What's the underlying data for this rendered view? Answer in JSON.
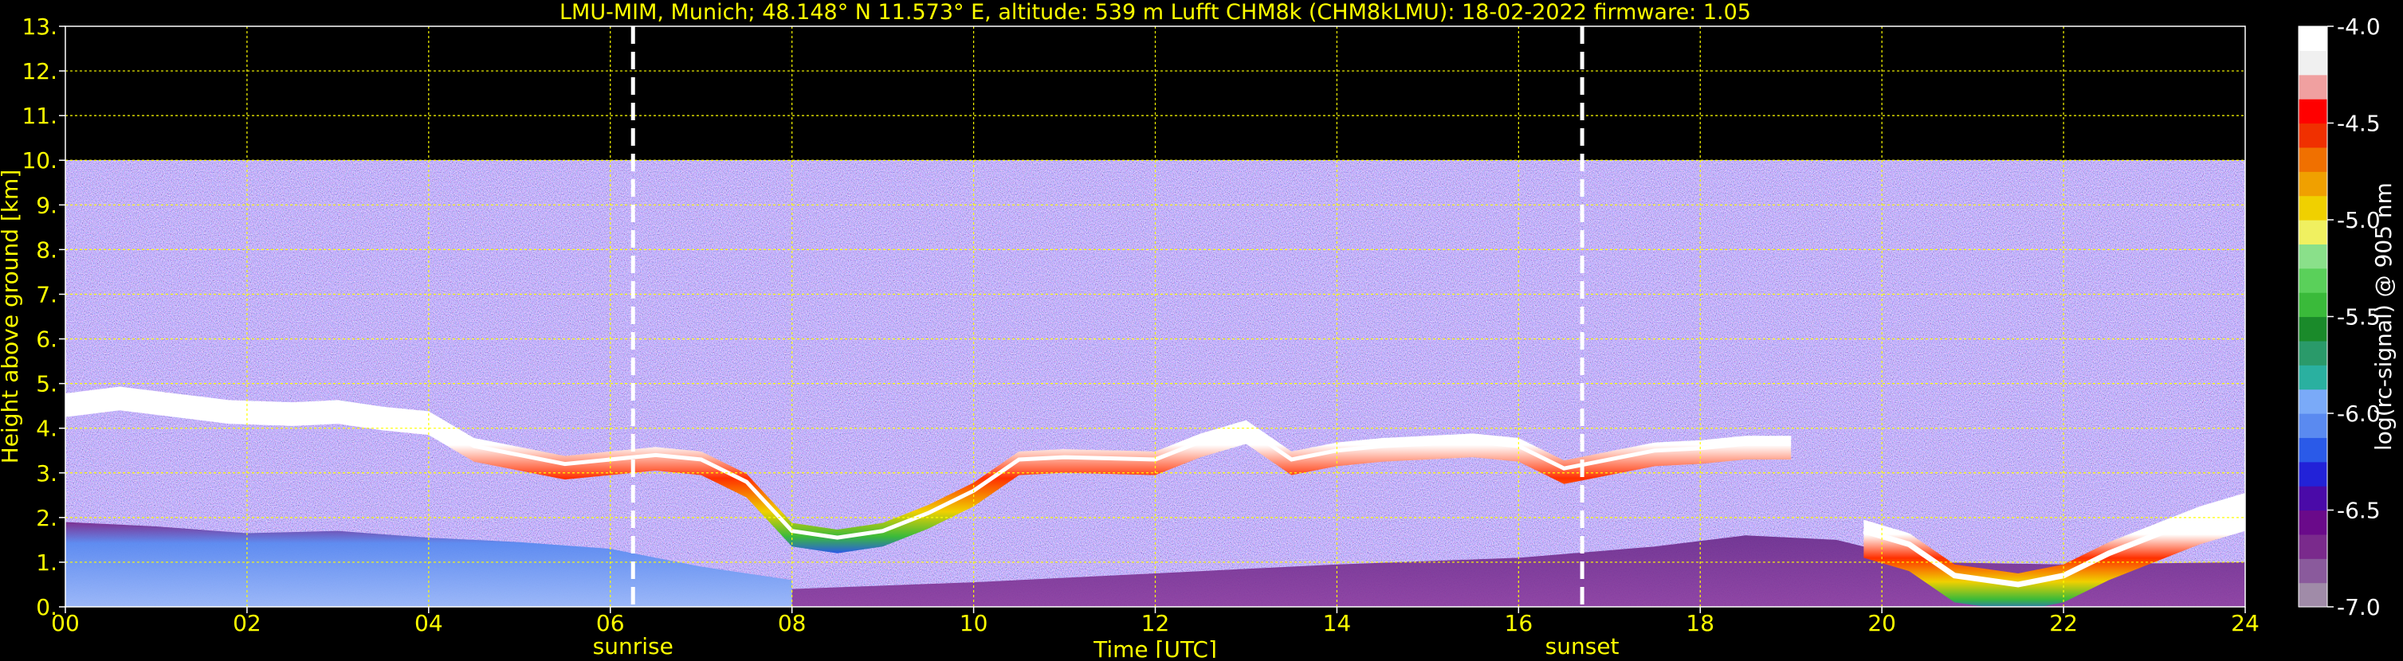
{
  "chart_data": {
    "type": "heatmap",
    "title": "LMU-MIM, Munich; 48.148° N 11.573° E, altitude: 539 m    Lufft CHM8k (CHM8kLMU): 18-02-2022    firmware: 1.05",
    "xlabel": "Time [UTC]",
    "ylabel": "Height above ground [km]",
    "xlim": [
      0,
      24
    ],
    "ylim": [
      0,
      13
    ],
    "xticks": [
      0,
      2,
      4,
      6,
      8,
      10,
      12,
      14,
      16,
      18,
      20,
      22,
      24
    ],
    "xtick_labels": [
      "00",
      "02",
      "04",
      "06",
      "08",
      "10",
      "12",
      "14",
      "16",
      "18",
      "20",
      "22",
      "24"
    ],
    "yticks": [
      0,
      1,
      2,
      3,
      4,
      5,
      6,
      7,
      8,
      9,
      10,
      11,
      12,
      13
    ],
    "ytick_labels": [
      "0.",
      "1.",
      "2.",
      "3.",
      "4.",
      "5.",
      "6.",
      "7.",
      "8.",
      "9.",
      "10.",
      "11.",
      "12.",
      "13."
    ],
    "grid": true,
    "grid_color": "#ffff00",
    "data_top_km": 10,
    "events": [
      {
        "label": "sunrise",
        "time": 6.25
      },
      {
        "label": "sunset",
        "time": 16.7
      }
    ],
    "colorbar": {
      "label": "log(rc-signal) @ 905 nm",
      "range": [
        -7.0,
        -4.0
      ],
      "ticks": [
        -4.0,
        -4.5,
        -5.0,
        -5.5,
        -6.0,
        -6.5,
        -7.0
      ],
      "tick_labels": [
        "-4.0",
        "-4.5",
        "-5.0",
        "-5.5",
        "-6.0",
        "-6.5",
        "-7.0"
      ],
      "colors": [
        "#a08ba8",
        "#8a5a9c",
        "#7a2a8c",
        "#6a0a8a",
        "#4a0aa8",
        "#2222d8",
        "#2a5ae8",
        "#5a8af0",
        "#7aaaf8",
        "#2ab0a0",
        "#2a9a6a",
        "#1a8a2a",
        "#3aba3a",
        "#5ad05a",
        "#8ae08a",
        "#f0f060",
        "#f0d000",
        "#f0a000",
        "#f07000",
        "#f03000",
        "#ff0000",
        "#f0a0a0",
        "#f0f0f0",
        "#ffffff"
      ]
    },
    "features": {
      "boundary_layer_morning": [
        {
          "t": 0.0,
          "top": 1.9
        },
        {
          "t": 1.0,
          "top": 1.8
        },
        {
          "t": 2.0,
          "top": 1.65
        },
        {
          "t": 3.0,
          "top": 1.7
        },
        {
          "t": 4.0,
          "top": 1.55
        },
        {
          "t": 5.0,
          "top": 1.45
        },
        {
          "t": 6.0,
          "top": 1.3
        },
        {
          "t": 7.0,
          "top": 0.9
        },
        {
          "t": 8.0,
          "top": 0.6
        }
      ],
      "aerosol_afternoon": [
        {
          "t": 8.0,
          "top": 0.4
        },
        {
          "t": 10.0,
          "top": 0.55
        },
        {
          "t": 12.0,
          "top": 0.75
        },
        {
          "t": 14.0,
          "top": 0.95
        },
        {
          "t": 16.0,
          "top": 1.1
        },
        {
          "t": 17.5,
          "top": 1.35
        },
        {
          "t": 18.5,
          "top": 1.6
        },
        {
          "t": 19.5,
          "top": 1.5
        },
        {
          "t": 20.5,
          "top": 1.0
        },
        {
          "t": 22.0,
          "top": 0.95
        },
        {
          "t": 24.0,
          "top": 1.0
        }
      ],
      "cloud_layer": [
        {
          "t": 0.0,
          "h": 4.6
        },
        {
          "t": 0.6,
          "h": 4.75
        },
        {
          "t": 1.2,
          "h": 4.6
        },
        {
          "t": 1.8,
          "h": 4.45
        },
        {
          "t": 2.5,
          "h": 4.4
        },
        {
          "t": 3.0,
          "h": 4.45
        },
        {
          "t": 3.5,
          "h": 4.3
        },
        {
          "t": 4.0,
          "h": 4.2
        },
        {
          "t": 4.5,
          "h": 3.6
        },
        {
          "t": 5.0,
          "h": 3.4
        },
        {
          "t": 5.5,
          "h": 3.2
        },
        {
          "t": 6.5,
          "h": 3.4
        },
        {
          "t": 7.0,
          "h": 3.3
        },
        {
          "t": 7.5,
          "h": 2.8
        },
        {
          "t": 8.0,
          "h": 1.7
        },
        {
          "t": 8.5,
          "h": 1.55
        },
        {
          "t": 9.0,
          "h": 1.7
        },
        {
          "t": 9.5,
          "h": 2.1
        },
        {
          "t": 10.0,
          "h": 2.6
        },
        {
          "t": 10.5,
          "h": 3.3
        },
        {
          "t": 11.0,
          "h": 3.35
        },
        {
          "t": 12.0,
          "h": 3.3
        },
        {
          "t": 12.5,
          "h": 3.7
        },
        {
          "t": 13.0,
          "h": 4.0
        },
        {
          "t": 13.5,
          "h": 3.3
        },
        {
          "t": 14.0,
          "h": 3.5
        },
        {
          "t": 14.5,
          "h": 3.6
        },
        {
          "t": 15.5,
          "h": 3.7
        },
        {
          "t": 16.0,
          "h": 3.6
        },
        {
          "t": 16.5,
          "h": 3.1
        },
        {
          "t": 17.0,
          "h": 3.3
        },
        {
          "t": 17.5,
          "h": 3.5
        },
        {
          "t": 18.0,
          "h": 3.55
        },
        {
          "t": 18.5,
          "h": 3.65
        },
        {
          "t": 19.0,
          "h": 3.65
        }
      ],
      "low_cloud_evening": [
        {
          "t": 19.8,
          "h": 1.7
        },
        {
          "t": 20.3,
          "h": 1.4
        },
        {
          "t": 20.8,
          "h": 0.7
        },
        {
          "t": 21.5,
          "h": 0.5
        },
        {
          "t": 22.0,
          "h": 0.7
        },
        {
          "t": 22.5,
          "h": 1.2
        },
        {
          "t": 23.0,
          "h": 1.6
        },
        {
          "t": 23.5,
          "h": 2.0
        },
        {
          "t": 24.0,
          "h": 2.3
        }
      ]
    }
  }
}
